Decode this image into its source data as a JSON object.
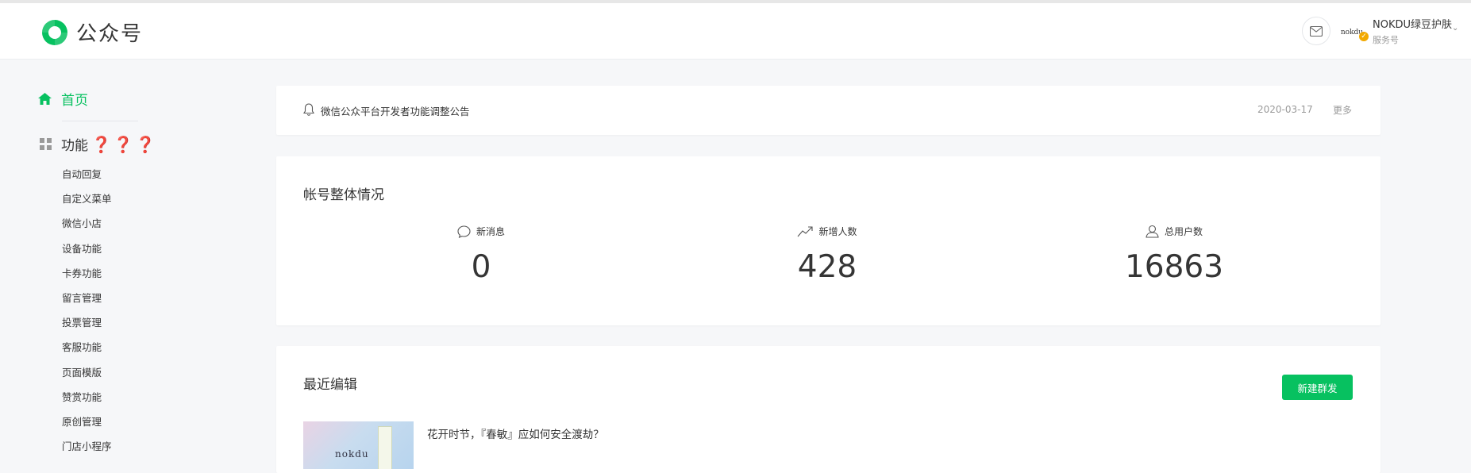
{
  "header": {
    "brand": "公众号",
    "account_name": "NOKDU绿豆护肤",
    "account_type": "服务号",
    "avatar_text": "nokdu"
  },
  "sidebar": {
    "home_label": "首页",
    "function_label": "功能",
    "function_marks": "❓❓❓",
    "items": [
      "自动回复",
      "自定义菜单",
      "微信小店",
      "设备功能",
      "卡券功能",
      "留言管理",
      "投票管理",
      "客服功能",
      "页面模版",
      "赞赏功能",
      "原创管理",
      "门店小程序"
    ]
  },
  "notice": {
    "text": "微信公众平台开发者功能调整公告",
    "date": "2020-03-17",
    "more": "更多"
  },
  "overview": {
    "title": "帐号整体情况",
    "stats": [
      {
        "label": "新消息",
        "value": "0",
        "icon": "chat-bubble-icon"
      },
      {
        "label": "新增人数",
        "value": "428",
        "icon": "trend-up-icon"
      },
      {
        "label": "总用户数",
        "value": "16863",
        "icon": "user-icon"
      }
    ]
  },
  "recent": {
    "title": "最近编辑",
    "new_button": "新建群发",
    "articles": [
      {
        "title": "花开时节，『春敏』应如何安全渡劫？",
        "thumb_text": "nokdu"
      }
    ]
  },
  "colors": {
    "accent": "#07c160",
    "warning_marks": "#e02020",
    "background": "#f6f7f9"
  }
}
